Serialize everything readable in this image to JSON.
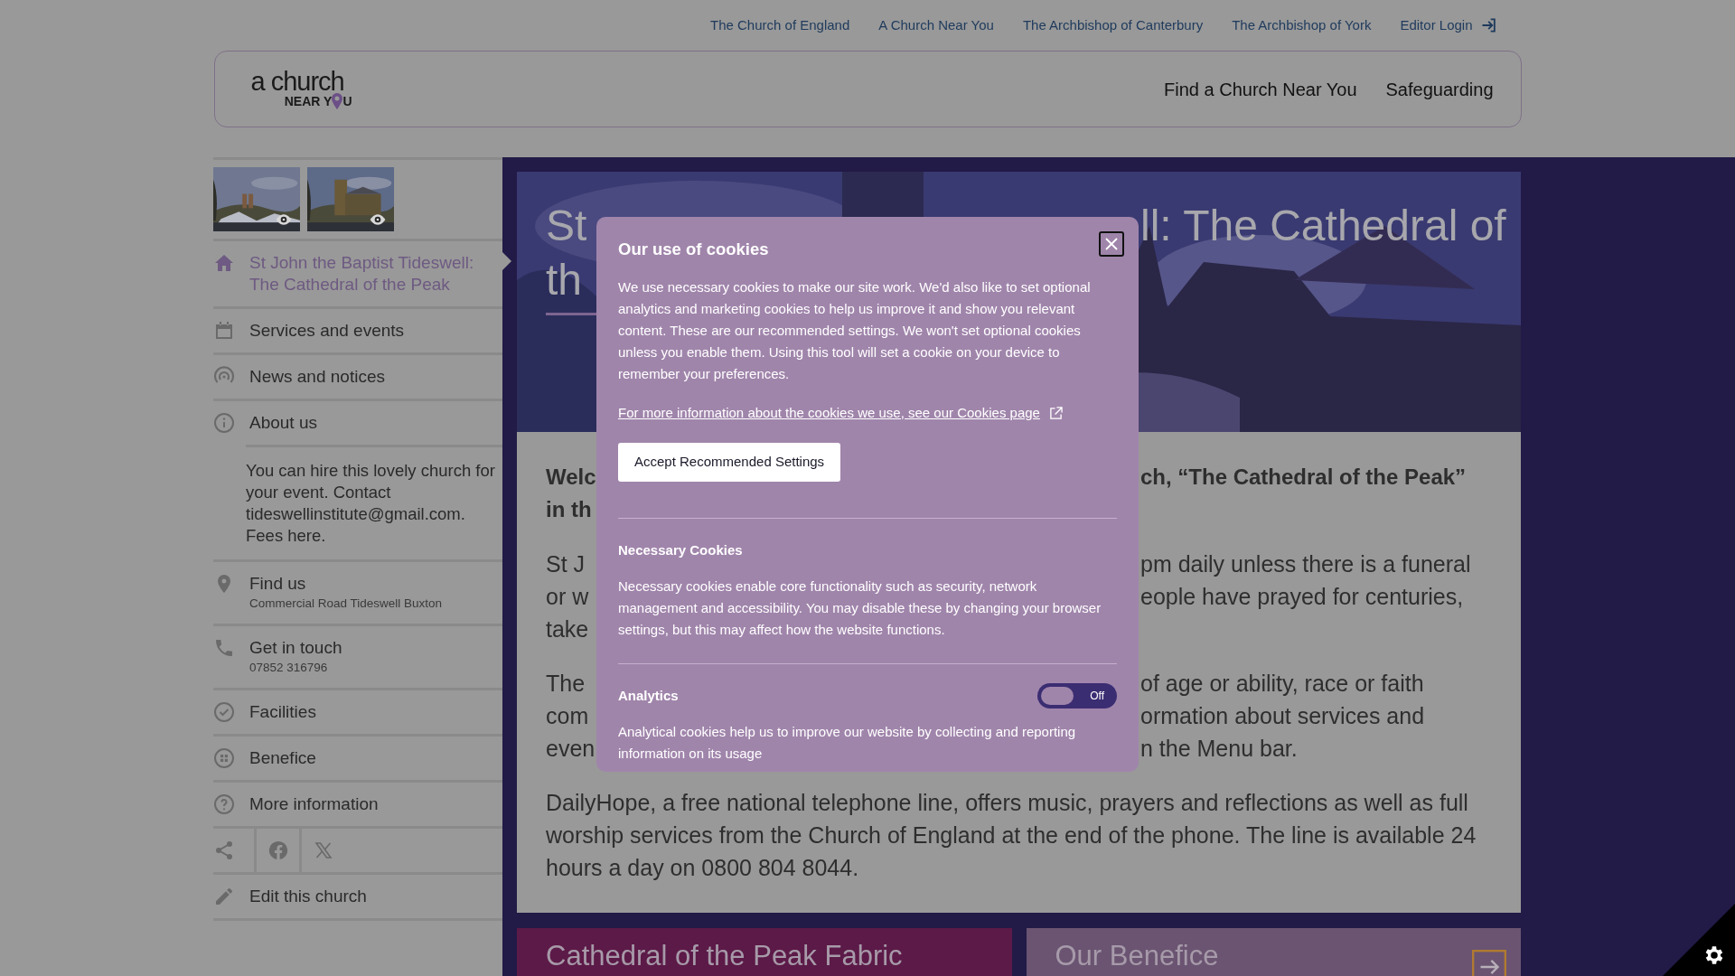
{
  "top_links": [
    {
      "kind": "link",
      "label": "The Church of England"
    },
    {
      "kind": "link",
      "label": "A Church Near You"
    },
    {
      "kind": "link",
      "label": "The Archbishop of Canterbury"
    },
    {
      "kind": "link",
      "label": "The Archbishop of York"
    },
    {
      "kind": "login",
      "label": "Editor Login"
    }
  ],
  "logo": {
    "top": "a church",
    "bottom_start": "NEAR Y",
    "bottom_end": "U"
  },
  "main_nav": [
    "Find a Church Near You",
    "Safeguarding"
  ],
  "sidebar": {
    "items": [
      {
        "kind": "home",
        "label": "St John the Baptist Tideswell: The Cathedral of the Peak",
        "selected": true
      },
      {
        "kind": "calendar",
        "label": "Services and events",
        "selected": false
      },
      {
        "kind": "broadcast",
        "label": "News and notices",
        "selected": false
      },
      {
        "kind": "info",
        "label": "About us",
        "selected": false,
        "note": "You can hire this lovely church for your event. Contact tideswellinstitute@gmail.com. Fees here."
      },
      {
        "kind": "pin",
        "label": "Find us",
        "selected": false,
        "detail": "Commercial Road Tideswell Buxton"
      },
      {
        "kind": "phone",
        "label": "Get in touch",
        "selected": false,
        "detail": "07852 316796"
      },
      {
        "kind": "check",
        "label": "Facilities",
        "selected": false
      },
      {
        "kind": "grid",
        "label": "Benefice",
        "selected": false
      },
      {
        "kind": "question",
        "label": "More information",
        "selected": false
      }
    ],
    "share": [
      {
        "kind": "share"
      },
      {
        "kind": "facebook"
      },
      {
        "kind": "x"
      }
    ],
    "edit": {
      "label": "Edit this church"
    }
  },
  "main": {
    "title_lines": [
      {
        "left": "St",
        "right": "ll: The Cathedral of"
      },
      {
        "left": "th"
      }
    ],
    "intro_lines": [
      {
        "left": "Welc",
        "right": "ch, “The Cathedral of the Peak”"
      },
      {
        "left": "in th"
      }
    ],
    "paragraphs": [
      [
        {
          "left": "St J",
          "right": "pm daily unless there is a funeral"
        },
        {
          "left": "or w",
          "right": "eople have prayed for centuries,"
        },
        {
          "left": "take"
        }
      ],
      [
        {
          "left": "The",
          "right": "of age or ability, race or faith"
        },
        {
          "left": "com",
          "right": "ormation about services and"
        },
        {
          "left": "even",
          "right": "n the Menu bar."
        }
      ]
    ],
    "full_paragraph": "DailyHope, a free national telephone line, offers music, prayers and reflections as well as full worship services from the Church of England at the end of the phone. The line is available 24 hours a day on 0800 804 8044.",
    "cards": [
      {
        "kind": "plain",
        "title": "Cathedral of the Peak Fabric",
        "color": "#5c1a48"
      },
      {
        "kind": "link",
        "title": "Our Benefice",
        "color": "#6a5472"
      }
    ]
  },
  "cookie_dialog": {
    "title": "Our use of cookies",
    "intro": "We use necessary cookies to make our site work. We'd also like to set optional analytics and marketing cookies to help us improve it and show you relevant content. These are our recommended settings. We won't set optional cookies unless you enable them. Using this tool will set a cookie on your device to remember your preferences.",
    "more_link": "For more information about the cookies we use, see our Cookies page",
    "accept_button": "Accept Recommended Settings",
    "sections": [
      {
        "kind": "info",
        "title": "Necessary Cookies",
        "text": "Necessary cookies enable core functionality such as security, network management and accessibility. You may disable these by changing your browser settings, but this may affect how the website functions."
      },
      {
        "kind": "toggle",
        "title": "Analytics",
        "on": false,
        "toggle_text": "Off",
        "text": "Analytical cookies help us to improve our website by collecting and reporting information on its usage"
      }
    ]
  }
}
